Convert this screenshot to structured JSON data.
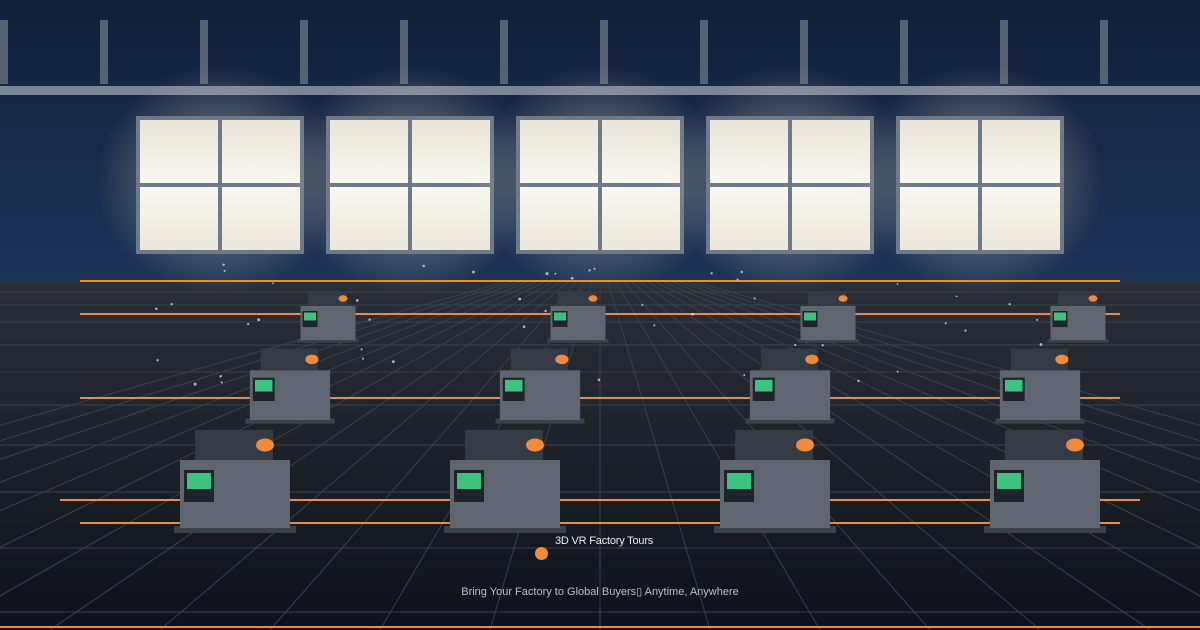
{
  "brand": {
    "title": "3D VR Factory Tours",
    "tagline": "Bring Your Factory to Global Buyers▯ Anytime, Anywhere"
  },
  "colors": {
    "accent": "#f08a3c",
    "screen": "#3cc47e",
    "machine_body": "#5f6672",
    "machine_top": "#353b44",
    "window_light": "#f2efe8",
    "wall": "#152641"
  },
  "scene": {
    "windows": 5,
    "window_panes_each": 4,
    "machine_rows": 3,
    "machines_per_row": 4
  }
}
